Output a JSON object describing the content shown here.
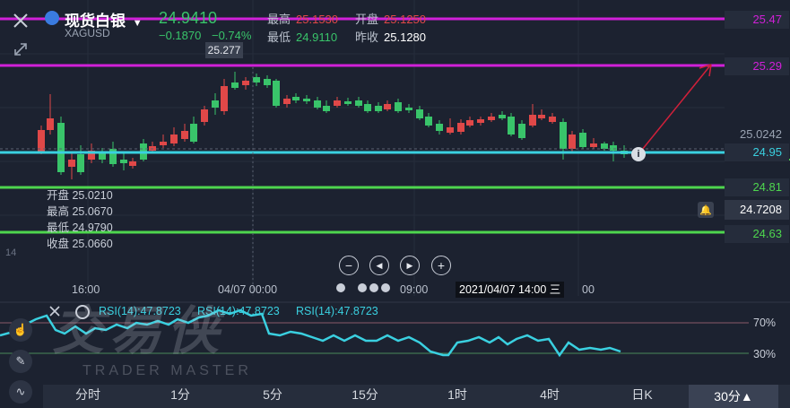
{
  "symbol": {
    "name": "现货白银",
    "code": "XAGUSD",
    "price": "24.9410",
    "change": "−0.1870",
    "change_pct": "−0.74%"
  },
  "quote": {
    "high_label": "最高",
    "high": "25.1530",
    "open_label": "开盘",
    "open": "25.1250",
    "low_label": "最低",
    "low": "24.9110",
    "prev_label": "昨收",
    "prev": "25.1280"
  },
  "callout_high": "25.277",
  "levels": {
    "l1": "25.47",
    "l2": "25.29",
    "current": "25.0242",
    "l3": "24.95",
    "l4": "24.81",
    "alert": "24.7208",
    "l5": "24.63"
  },
  "ohlc": {
    "open": "开盘 25.0210",
    "high": "最高 25.0670",
    "low": "最低 24.9790",
    "close": "收盘 25.0660"
  },
  "axis_left_fragment": "14",
  "time_axis": {
    "t1": "16:00",
    "t2": "04/07 00:00",
    "t3": "09:00",
    "crosshair": "2021/04/07 14:00 三",
    "tail": "00"
  },
  "controls": {
    "zoom_out": "−",
    "prev": "◀",
    "next": "▶",
    "zoom_in": "+"
  },
  "rsi": {
    "labels": [
      "RSI(14):47.8723",
      "RSI(14):47.8723",
      "RSI(14):47.8723"
    ],
    "level_high": "70%",
    "level_low": "30%"
  },
  "watermark": {
    "main": "交易侠",
    "sub": "TRADER MASTER"
  },
  "timeframes": [
    "分时",
    "1分",
    "5分",
    "15分",
    "1时",
    "4时",
    "日K",
    "30分▲"
  ],
  "colors": {
    "bg": "#1c2230",
    "up": "#e04848",
    "down": "#39c46a",
    "magenta": "#d020d8",
    "cyan": "#3ad0e0",
    "green_line": "#4ed64e",
    "accent_arrow": "#d0203a"
  }
}
